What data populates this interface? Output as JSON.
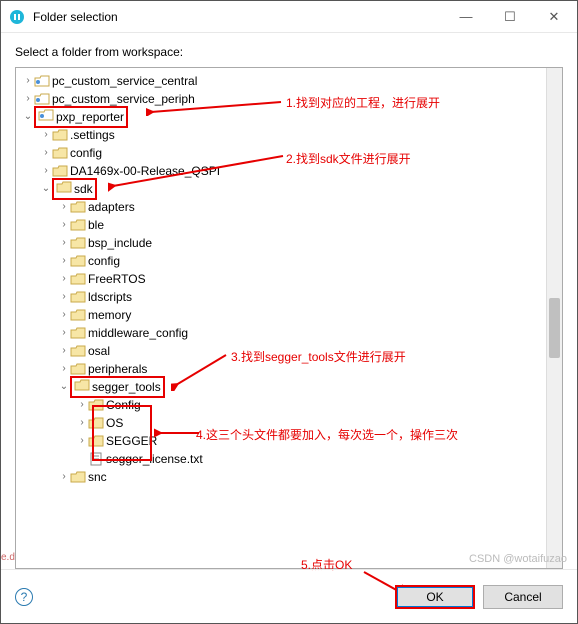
{
  "window": {
    "title": "Folder selection",
    "minimize": "—",
    "maximize": "☐",
    "close": "✕"
  },
  "prompt": "Select a folder from workspace:",
  "tree": [
    {
      "depth": 0,
      "tw": ">",
      "icon": "project",
      "label": "pc_custom_service_central"
    },
    {
      "depth": 0,
      "tw": ">",
      "icon": "project",
      "label": "pc_custom_service_periph"
    },
    {
      "depth": 0,
      "tw": "v",
      "icon": "project",
      "label": "pxp_reporter",
      "hl": true
    },
    {
      "depth": 1,
      "tw": ">",
      "icon": "folder",
      "label": ".settings"
    },
    {
      "depth": 1,
      "tw": ">",
      "icon": "folder",
      "label": "config"
    },
    {
      "depth": 1,
      "tw": ">",
      "icon": "folder",
      "label": "DA1469x-00-Release_QSPI"
    },
    {
      "depth": 1,
      "tw": "v",
      "icon": "folder",
      "label": "sdk",
      "hl": true
    },
    {
      "depth": 2,
      "tw": ">",
      "icon": "folder",
      "label": "adapters"
    },
    {
      "depth": 2,
      "tw": ">",
      "icon": "folder",
      "label": "ble"
    },
    {
      "depth": 2,
      "tw": ">",
      "icon": "folder",
      "label": "bsp_include"
    },
    {
      "depth": 2,
      "tw": ">",
      "icon": "folder",
      "label": "config"
    },
    {
      "depth": 2,
      "tw": ">",
      "icon": "folder",
      "label": "FreeRTOS"
    },
    {
      "depth": 2,
      "tw": ">",
      "icon": "folder",
      "label": "ldscripts"
    },
    {
      "depth": 2,
      "tw": ">",
      "icon": "folder",
      "label": "memory"
    },
    {
      "depth": 2,
      "tw": ">",
      "icon": "folder",
      "label": "middleware_config"
    },
    {
      "depth": 2,
      "tw": ">",
      "icon": "folder",
      "label": "osal"
    },
    {
      "depth": 2,
      "tw": ">",
      "icon": "folder",
      "label": "peripherals"
    },
    {
      "depth": 2,
      "tw": "v",
      "icon": "folder-open",
      "label": "segger_tools",
      "hl": true
    },
    {
      "depth": 3,
      "tw": ">",
      "icon": "folder",
      "label": "Config",
      "group": true
    },
    {
      "depth": 3,
      "tw": ">",
      "icon": "folder",
      "label": "OS",
      "group": true
    },
    {
      "depth": 3,
      "tw": ">",
      "icon": "folder",
      "label": "SEGGER",
      "group": true
    },
    {
      "depth": 3,
      "tw": "",
      "icon": "file",
      "label": "segger_license.txt"
    },
    {
      "depth": 2,
      "tw": ">",
      "icon": "folder",
      "label": "snc"
    }
  ],
  "annotations": {
    "a1": "1.找到对应的工程，进行展开",
    "a2": "2.找到sdk文件进行展开",
    "a3": "3.找到segger_tools文件进行展开",
    "a4": "4.这三个头文件都要加入，每次选一个，操作三次",
    "a5": "5.点击OK"
  },
  "buttons": {
    "ok": "OK",
    "cancel": "Cancel"
  },
  "watermark": "CSDN @wotaifuzao",
  "ed": "e.d"
}
